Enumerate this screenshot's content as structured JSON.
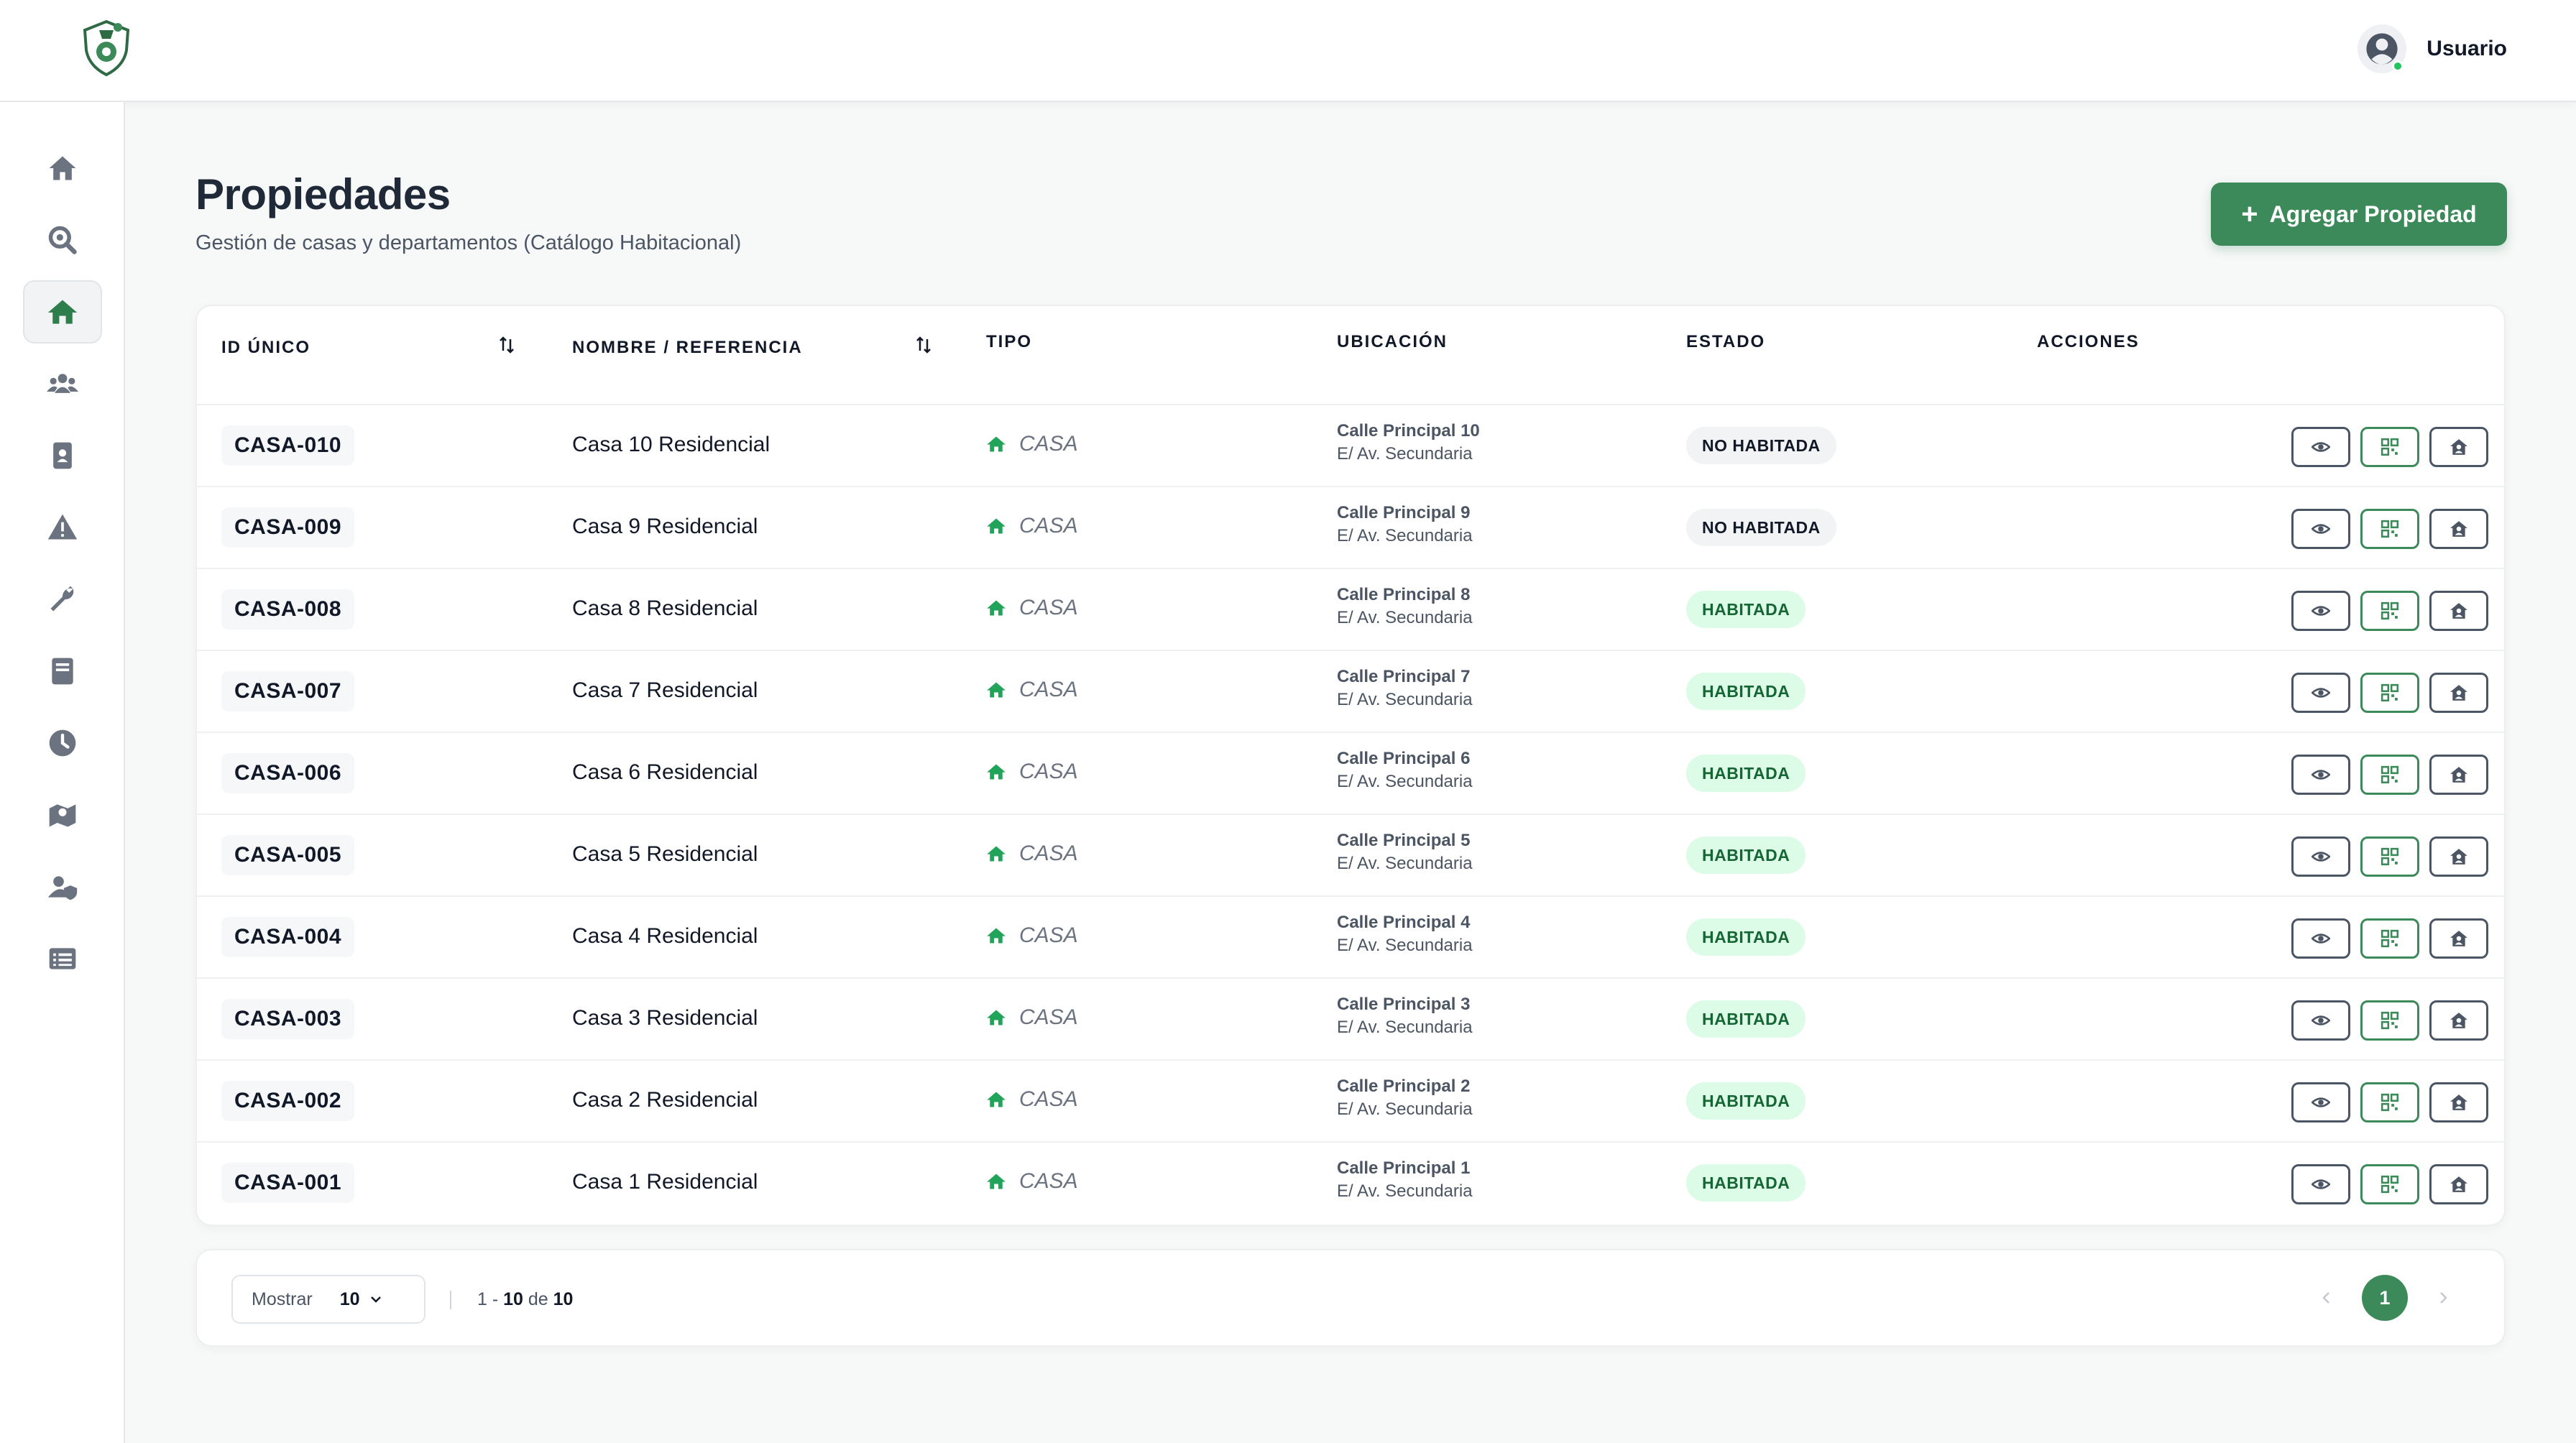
{
  "header": {
    "user_name": "Usuario"
  },
  "sidebar": {
    "items": [
      {
        "icon": "home-icon"
      },
      {
        "icon": "search-location-icon"
      },
      {
        "icon": "properties-icon",
        "active": true
      },
      {
        "icon": "users-icon"
      },
      {
        "icon": "id-badge-icon"
      },
      {
        "icon": "alert-icon"
      },
      {
        "icon": "wrench-icon"
      },
      {
        "icon": "book-icon"
      },
      {
        "icon": "clock-icon"
      },
      {
        "icon": "map-icon"
      },
      {
        "icon": "user-shield-icon"
      },
      {
        "icon": "list-icon"
      }
    ]
  },
  "page": {
    "title": "Propiedades",
    "subtitle": "Gestión de casas y departamentos (Catálogo Habitacional)",
    "add_button": "Agregar Propiedad"
  },
  "table": {
    "headers": {
      "id": "ID ÚNICO",
      "name": "NOMBRE / REFERENCIA",
      "type": "TIPO",
      "location": "UBICACIÓN",
      "status": "ESTADO",
      "actions": "ACCIONES"
    },
    "rows": [
      {
        "id": "CASA-010",
        "name": "Casa 10 Residencial",
        "type": "CASA",
        "street": "Calle Principal 10",
        "cross": "E/ Av. Secundaria",
        "status": "NO HABITADA"
      },
      {
        "id": "CASA-009",
        "name": "Casa 9 Residencial",
        "type": "CASA",
        "street": "Calle Principal 9",
        "cross": "E/ Av. Secundaria",
        "status": "NO HABITADA"
      },
      {
        "id": "CASA-008",
        "name": "Casa 8 Residencial",
        "type": "CASA",
        "street": "Calle Principal 8",
        "cross": "E/ Av. Secundaria",
        "status": "HABITADA"
      },
      {
        "id": "CASA-007",
        "name": "Casa 7 Residencial",
        "type": "CASA",
        "street": "Calle Principal 7",
        "cross": "E/ Av. Secundaria",
        "status": "HABITADA"
      },
      {
        "id": "CASA-006",
        "name": "Casa 6 Residencial",
        "type": "CASA",
        "street": "Calle Principal 6",
        "cross": "E/ Av. Secundaria",
        "status": "HABITADA"
      },
      {
        "id": "CASA-005",
        "name": "Casa 5 Residencial",
        "type": "CASA",
        "street": "Calle Principal 5",
        "cross": "E/ Av. Secundaria",
        "status": "HABITADA"
      },
      {
        "id": "CASA-004",
        "name": "Casa 4 Residencial",
        "type": "CASA",
        "street": "Calle Principal 4",
        "cross": "E/ Av. Secundaria",
        "status": "HABITADA"
      },
      {
        "id": "CASA-003",
        "name": "Casa 3 Residencial",
        "type": "CASA",
        "street": "Calle Principal 3",
        "cross": "E/ Av. Secundaria",
        "status": "HABITADA"
      },
      {
        "id": "CASA-002",
        "name": "Casa 2 Residencial",
        "type": "CASA",
        "street": "Calle Principal 2",
        "cross": "E/ Av. Secundaria",
        "status": "HABITADA"
      },
      {
        "id": "CASA-001",
        "name": "Casa 1 Residencial",
        "type": "CASA",
        "street": "Calle Principal 1",
        "cross": "E/ Av. Secundaria",
        "status": "HABITADA"
      }
    ]
  },
  "footer": {
    "show_label": "Mostrar",
    "page_size": "10",
    "range_start": "1",
    "range_end": "10",
    "range_of": "de",
    "total": "10",
    "current_page": "1"
  },
  "colors": {
    "brand": "#3c8a5a",
    "brand_light": "#22a35a",
    "danger": "#f87171",
    "status_inhabited_bg": "#dcfce7",
    "status_inhabited_fg": "#166534",
    "status_uninhabited_bg": "#f1f3f4",
    "status_uninhabited_fg": "#111827"
  }
}
